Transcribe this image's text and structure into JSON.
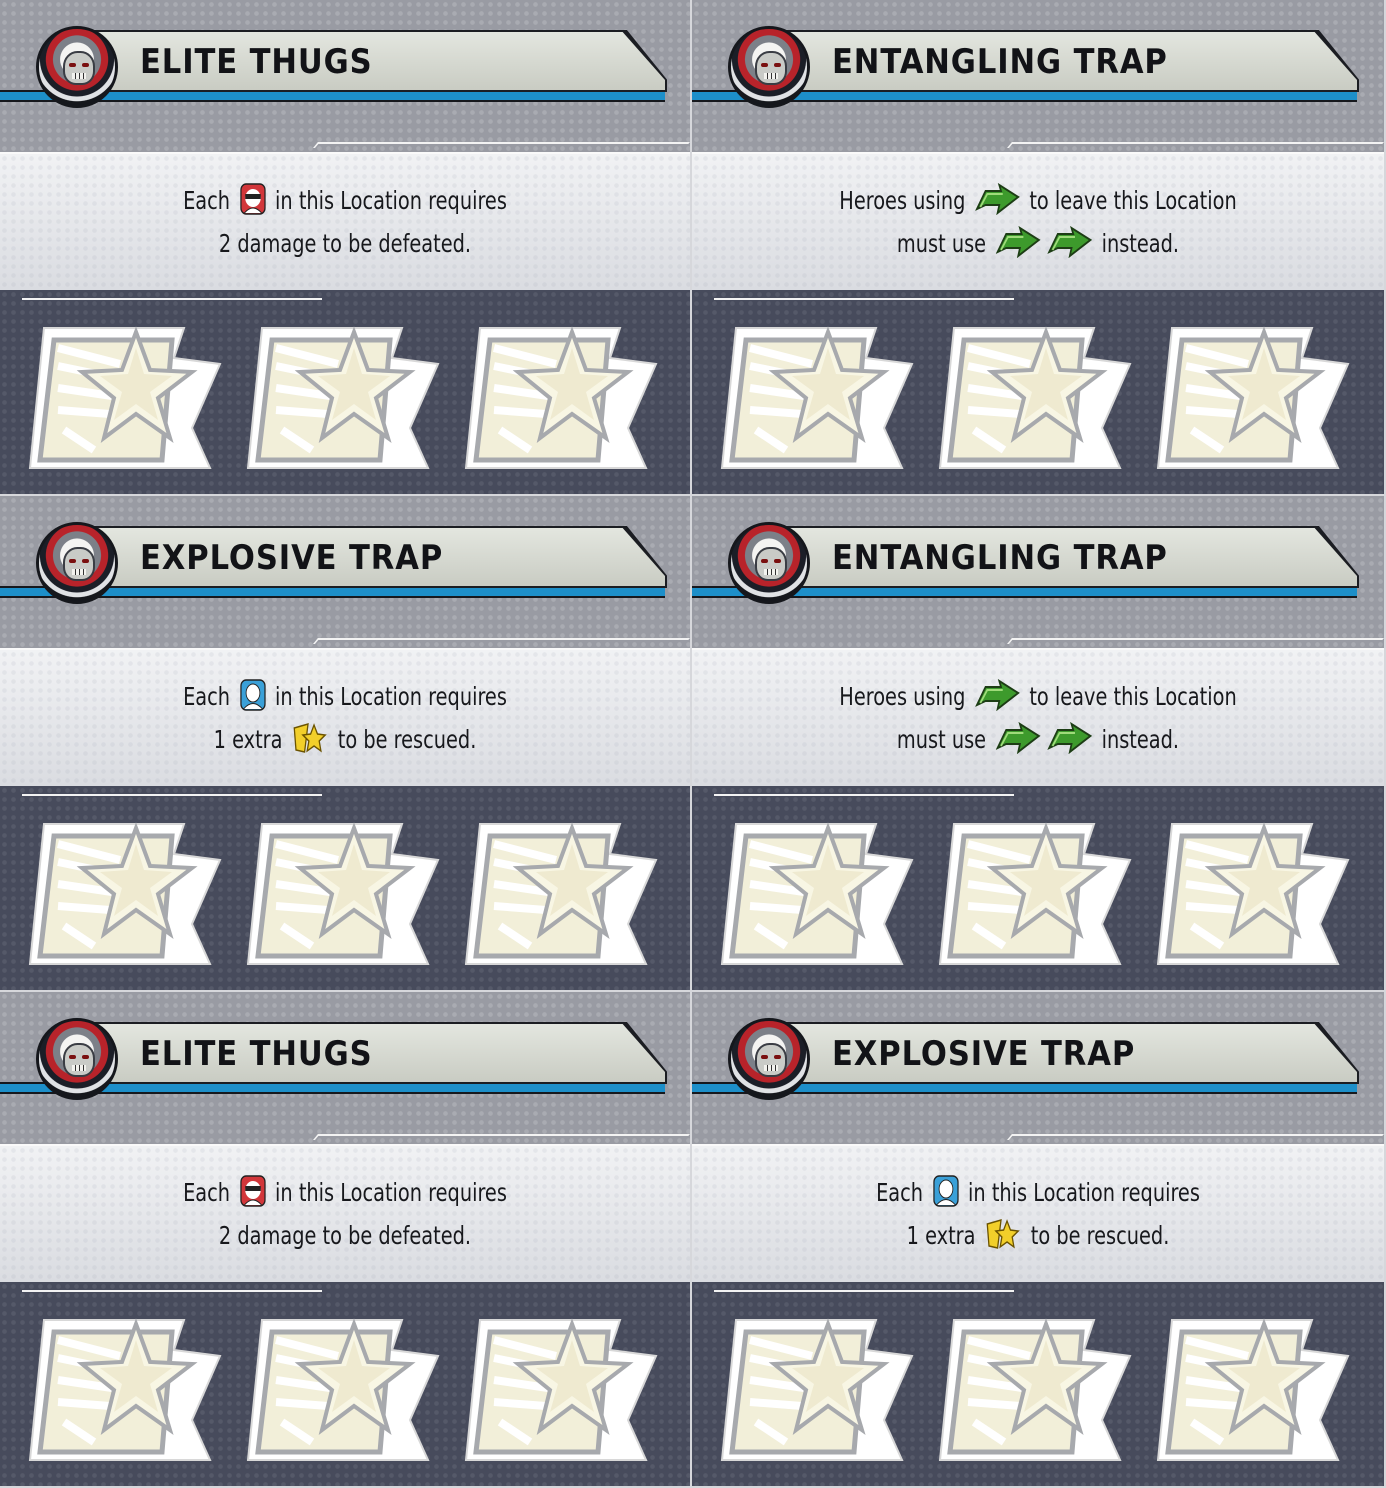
{
  "cards": [
    {
      "title": "ELITE THUGS",
      "line1": {
        "before": "Each",
        "icon": "thug-icon",
        "after": "in this Location requires"
      },
      "line2": {
        "before": "2 damage to be defeated.",
        "icon": null,
        "after": ""
      }
    },
    {
      "title": "ENTANGLING TRAP",
      "line1": {
        "before": "Heroes using",
        "icon": "move-arrow-icon",
        "after": "to leave this Location"
      },
      "line2": {
        "before": "must use",
        "icon": "double-move-arrow-icon",
        "after": "instead."
      }
    },
    {
      "title": "EXPLOSIVE TRAP",
      "line1": {
        "before": "Each",
        "icon": "civilian-icon",
        "after": "in this Location requires"
      },
      "line2": {
        "before": "1 extra",
        "icon": "rescue-star-icon",
        "after": "to be rescued."
      }
    },
    {
      "title": "ENTANGLING TRAP",
      "line1": {
        "before": "Heroes using",
        "icon": "move-arrow-icon",
        "after": "to leave this Location"
      },
      "line2": {
        "before": "must use",
        "icon": "double-move-arrow-icon",
        "after": "instead."
      }
    },
    {
      "title": "ELITE THUGS",
      "line1": {
        "before": "Each",
        "icon": "thug-icon",
        "after": "in this Location requires"
      },
      "line2": {
        "before": "2 damage to be defeated.",
        "icon": null,
        "after": ""
      }
    },
    {
      "title": "EXPLOSIVE TRAP",
      "line1": {
        "before": "Each",
        "icon": "civilian-icon",
        "after": "in this Location requires"
      },
      "line2": {
        "before": "1 extra",
        "icon": "rescue-star-icon",
        "after": "to be rescued."
      }
    }
  ],
  "colors": {
    "banner_stripe": "#1d8fc9",
    "thug_icon": "#d2363a",
    "civilian_icon": "#3aa0d8",
    "move_arrow": "#3d9a2c",
    "rescue_star": "#f2cf2a"
  },
  "token_count_per_card": 3
}
